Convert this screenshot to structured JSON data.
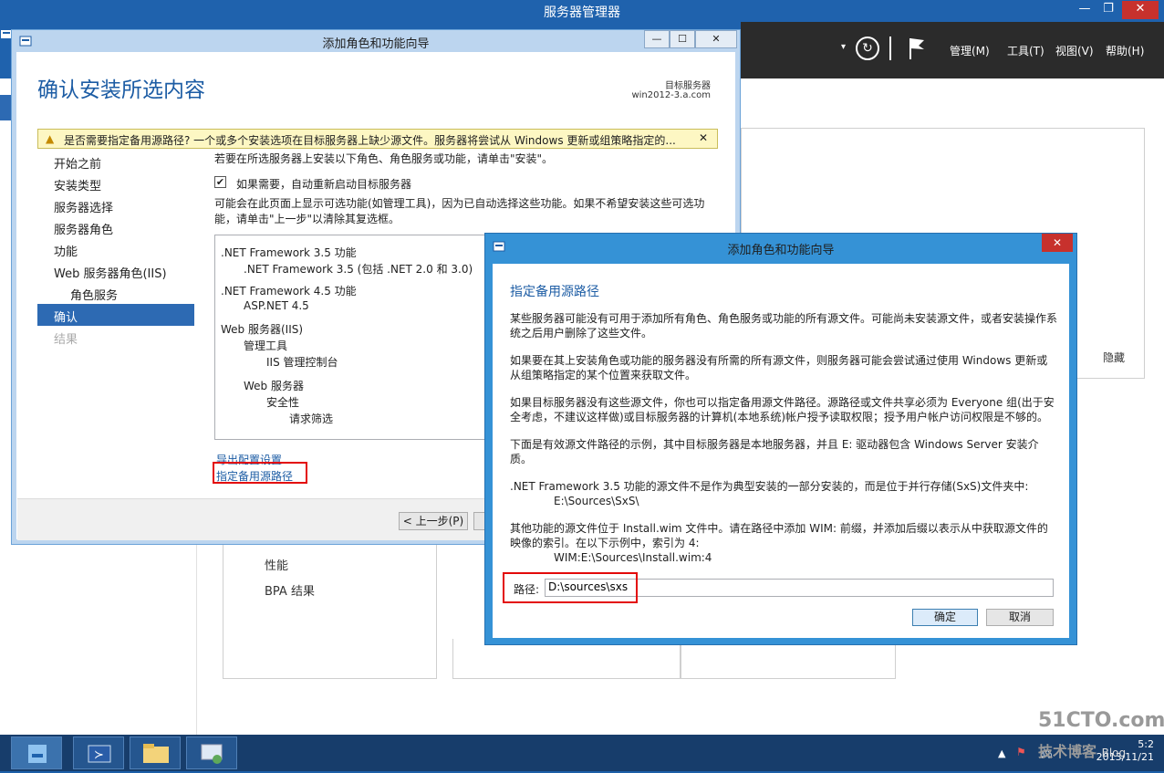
{
  "server_manager": {
    "title": "服务器管理器",
    "window_controls": {
      "minimize": "—",
      "restore": "❐",
      "close": "✕"
    },
    "menus": [
      "管理(M)",
      "工具(T)",
      "视图(V)",
      "帮助(H)"
    ],
    "hide_label": "隐藏",
    "tile_items": [
      "性能",
      "BPA 结果"
    ]
  },
  "wizard": {
    "title": "添加角色和功能向导",
    "heading": "确认安装所选内容",
    "target_label": "目标服务器",
    "target_name": "win2012-3.a.com",
    "warning": "是否需要指定备用源路径? 一个或多个安装选项在目标服务器上缺少源文件。服务器将尝试从 Windows 更新或组策略指定的...",
    "steps": [
      "开始之前",
      "安装类型",
      "服务器选择",
      "服务器角色",
      "功能",
      "Web 服务器角色(IIS)",
      "角色服务",
      "确认",
      "结果"
    ],
    "intro": "若要在所选服务器上安装以下角色、角色服务或功能，请单击\"安装\"。",
    "restart_label": "如果需要，自动重新启动目标服务器",
    "restart_checked": "✔",
    "optional_note": "可能会在此页面上显示可选功能(如管理工具)，因为已自动选择这些功能。如果不希望安装这些可选功能，请单击\"上一步\"以清除其复选框。",
    "features": [
      ".NET Framework 3.5 功能",
      ".NET Framework 3.5 (包括 .NET 2.0 和 3.0)",
      ".NET Framework 4.5 功能",
      "ASP.NET 4.5",
      "Web 服务器(IIS)",
      "管理工具",
      "IIS 管理控制台",
      "Web 服务器",
      "安全性",
      "请求筛选"
    ],
    "link_export": "导出配置设置",
    "link_source": "指定备用源路径",
    "btn_prev": "< 上一步(P)",
    "btn_next": "下"
  },
  "dialog": {
    "title": "添加角色和功能向导",
    "close": "✕",
    "heading": "指定备用源路径",
    "para1": "某些服务器可能没有可用于添加所有角色、角色服务或功能的所有源文件。可能尚未安装源文件，或者安装操作系统之后用户删除了这些文件。",
    "para2": "如果要在其上安装角色或功能的服务器没有所需的所有源文件，则服务器可能会尝试通过使用 Windows 更新或从组策略指定的某个位置来获取文件。",
    "para3": "如果目标服务器没有这些源文件，你也可以指定备用源文件路径。源路径或文件共享必须为 Everyone 组(出于安全考虑，不建议这样做)或目标服务器的计算机(本地系统)帐户授予读取权限；授予用户帐户访问权限是不够的。",
    "para4": "下面是有效源文件路径的示例，其中目标服务器是本地服务器，并且 E: 驱动器包含 Windows Server 安装介质。",
    "para5": ".NET Framework 3.5 功能的源文件不是作为典型安装的一部分安装的，而是位于并行存储(SxS)文件夹中:",
    "para5_path": "E:\\Sources\\SxS\\",
    "para6": "其他功能的源文件位于 Install.wim 文件中。请在路径中添加 WIM: 前缀，并添加后缀以表示从中获取源文件的映像的索引。在以下示例中，索引为 4:",
    "para6_path": "WIM:E:\\Sources\\Install.wim:4",
    "path_label": "路径:",
    "path_value": "D:\\sources\\sxs",
    "btn_ok": "确定",
    "btn_cancel": "取消"
  },
  "taskbar": {
    "time": "5:2",
    "date": "2013/11/21"
  },
  "watermark": {
    "line1": "51CTO.com",
    "line2": "技术博客",
    "blog": "Blog"
  }
}
